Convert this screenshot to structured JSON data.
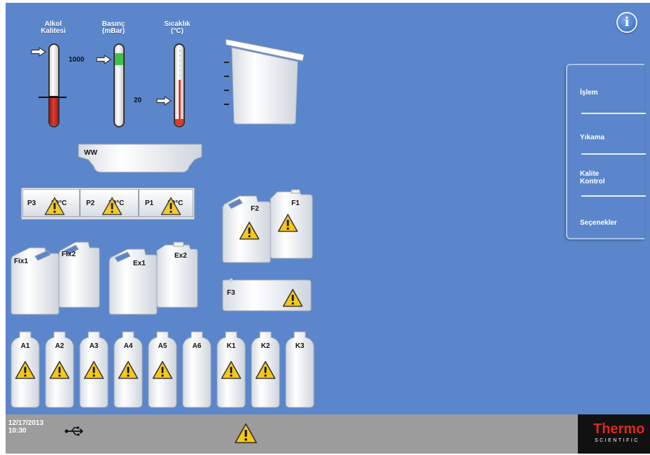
{
  "gauges": {
    "alcohol_quality": {
      "label_line1": "Alkol",
      "label_line2": "Kalitesi"
    },
    "pressure": {
      "label_line1": "Basınç",
      "label_line2": "(mBar)",
      "scale_max": "1000",
      "scale_min": "20"
    },
    "temperature": {
      "label_line1": "Sıcaklık",
      "label_line2": "(°C)"
    }
  },
  "tray_ww": {
    "label": "WW"
  },
  "paraffin": [
    {
      "label": "P3",
      "temp": "30°C"
    },
    {
      "label": "P2",
      "temp": "30°C"
    },
    {
      "label": "P1",
      "temp": "30°C"
    }
  ],
  "containers": {
    "fix1": "Fix1",
    "fix2": "Fix2",
    "ex1": "Ex1",
    "ex2": "Ex2",
    "f1": "F1",
    "f2": "F2",
    "f3": "F3"
  },
  "bottles": [
    {
      "label": "A1",
      "warning": true
    },
    {
      "label": "A2",
      "warning": true
    },
    {
      "label": "A3",
      "warning": true
    },
    {
      "label": "A4",
      "warning": true
    },
    {
      "label": "A5",
      "warning": true
    },
    {
      "label": "A6",
      "warning": false
    },
    {
      "label": "K1",
      "warning": true
    },
    {
      "label": "K2",
      "warning": true
    },
    {
      "label": "K3",
      "warning": false
    }
  ],
  "menu": {
    "process": "İşlem",
    "wash": "Yıkama",
    "quality_line1": "Kalite",
    "quality_line2": "Kontrol",
    "options": "Seçenekler"
  },
  "info_button": "i",
  "status": {
    "date": "12/17/2013",
    "time": "10:30",
    "usb_icon": "usb-icon",
    "warning_icon": "warning-icon"
  },
  "logo": {
    "brand": "Thermo",
    "sub": "SCIENTIFIC"
  },
  "colors": {
    "background": "#5b86cb",
    "warning_fill": "#f6c816",
    "alcohol_level": "#d42b22",
    "pressure_level": "#3fc24a",
    "temperature_level": "#e03a2e",
    "status_bar": "#9c9c9c"
  }
}
